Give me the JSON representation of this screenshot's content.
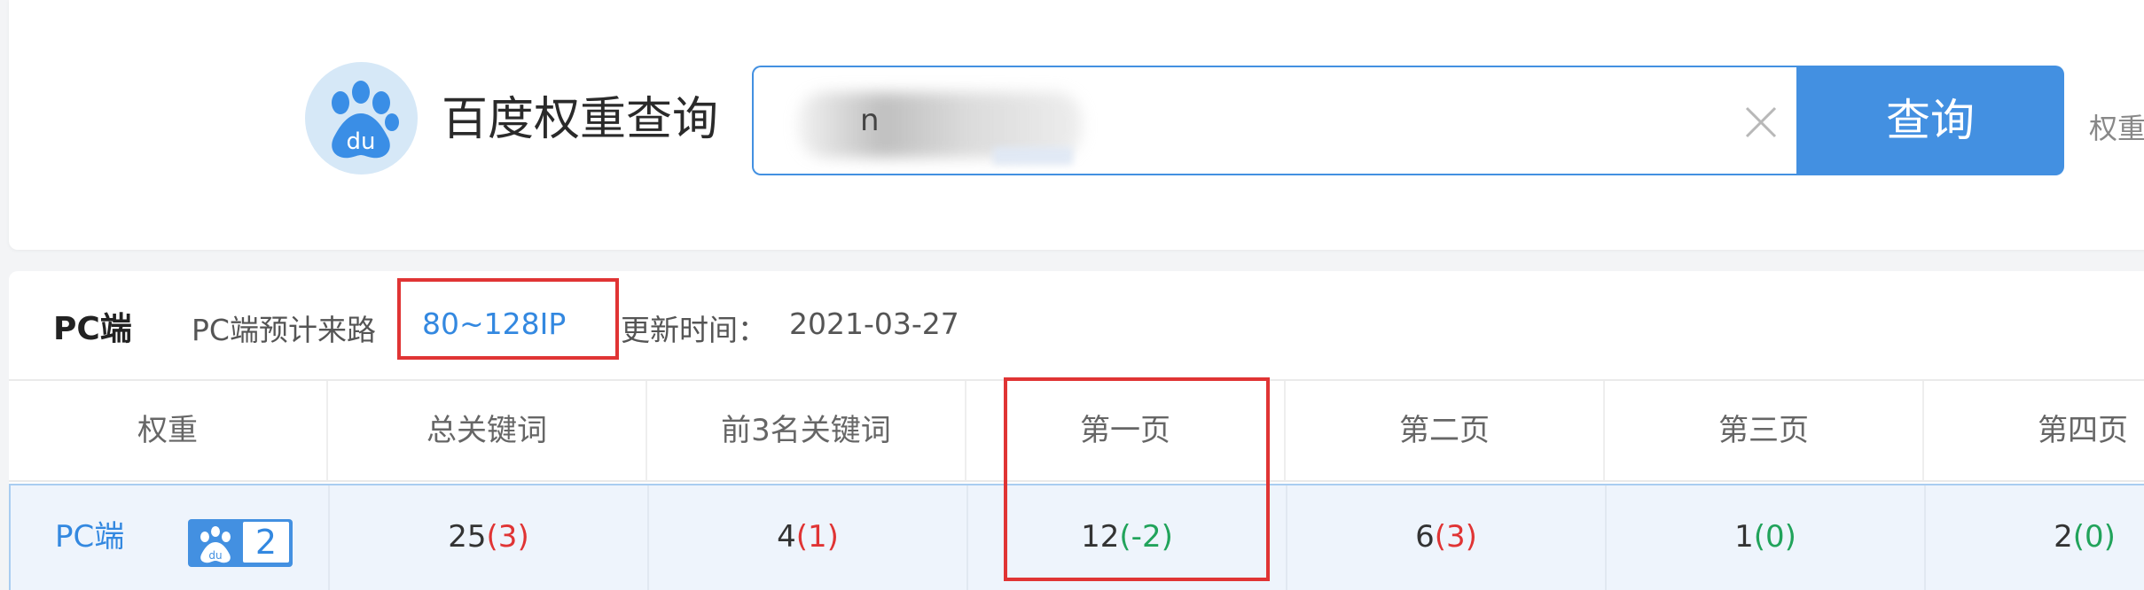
{
  "app": {
    "title": "百度权重查询",
    "logo_icon": "baidu-paw-logo-icon"
  },
  "search": {
    "value": "n",
    "button_label": "查询",
    "clear_icon": "close-icon"
  },
  "side_link": "权重",
  "pc_section": {
    "title": "PC端",
    "traffic_label": "PC端预计来路",
    "traffic_value": "80~128IP",
    "update_label": "更新时间：",
    "update_value": "2021-03-27"
  },
  "table": {
    "headers": [
      "权重",
      "总关键词",
      "前3名关键词",
      "第一页",
      "第二页",
      "第三页",
      "第四页"
    ],
    "row": {
      "label": "PC端",
      "badge_value": "2",
      "cells": [
        {
          "main": "25",
          "change": "(3)",
          "trend": "up"
        },
        {
          "main": "4",
          "change": "(1)",
          "trend": "up"
        },
        {
          "main": "12",
          "change": "(-2)",
          "trend": "down"
        },
        {
          "main": "6",
          "change": "(3)",
          "trend": "up"
        },
        {
          "main": "1",
          "change": "(0)",
          "trend": "flat"
        },
        {
          "main": "2",
          "change": "(0)",
          "trend": "flat"
        }
      ]
    }
  },
  "colors": {
    "primary": "#4390e1",
    "link": "#3388e0",
    "highlight": "#e03434",
    "increase": "#e03434",
    "decrease_or_zero": "#21a35b"
  }
}
